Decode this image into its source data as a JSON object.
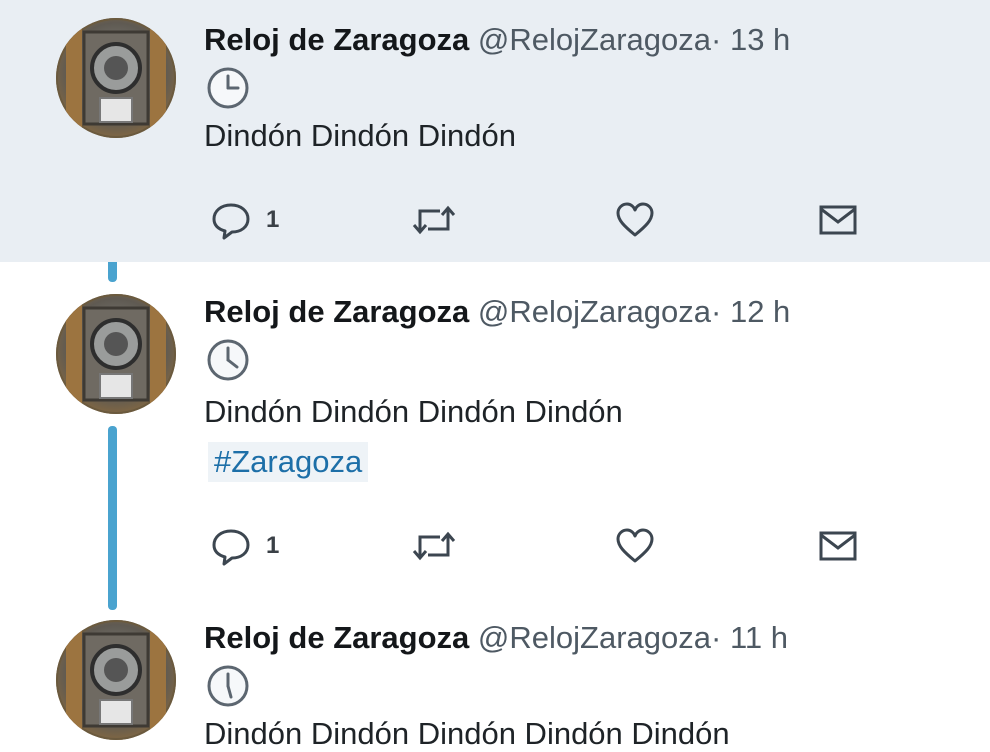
{
  "tweets": [
    {
      "name": "Reloj de Zaragoza",
      "handle": "@RelojZaragoza",
      "separator": "·",
      "time": "13 h",
      "text": "Dindón Dindón Dindón",
      "hashtag": "",
      "reply_count": "1",
      "highlighted": true
    },
    {
      "name": "Reloj de Zaragoza",
      "handle": "@RelojZaragoza",
      "separator": "·",
      "time": "12 h",
      "text": "Dindón Dindón Dindón Dindón",
      "hashtag": "#Zaragoza",
      "reply_count": "1",
      "highlighted": false
    },
    {
      "name": "Reloj de Zaragoza",
      "handle": "@RelojZaragoza",
      "separator": "·",
      "time": "11 h",
      "text": "Dindón Dindón Dindón Dindón Dindón",
      "hashtag": "",
      "reply_count": "",
      "highlighted": false
    }
  ],
  "icons": {
    "clock": "clock-icon",
    "reply": "reply-icon",
    "retweet": "retweet-icon",
    "like": "heart-icon",
    "message": "envelope-icon"
  },
  "colors": {
    "highlight_background": "#e9eef3",
    "thread_line": "#4aa3cf",
    "hashtag": "#1d6fa8",
    "icon_stroke": "#3c4650"
  }
}
